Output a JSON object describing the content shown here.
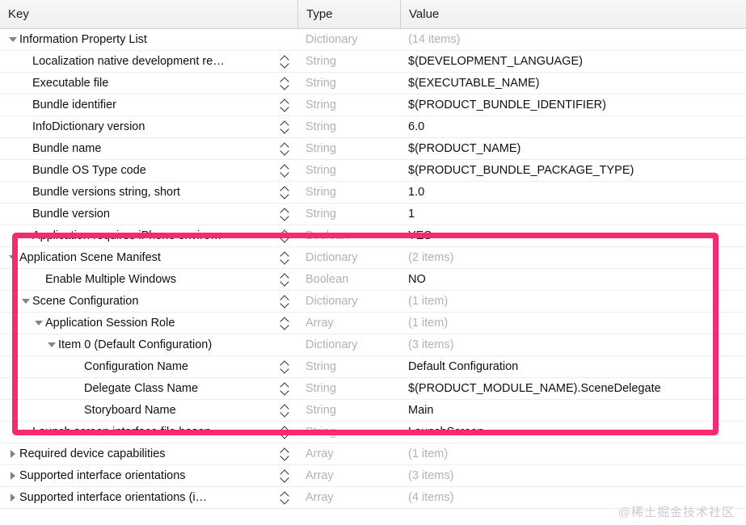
{
  "header": {
    "key_label": "Key",
    "type_label": "Type",
    "value_label": "Value"
  },
  "colors": {
    "highlight": "#f72a6d",
    "type_text": "#b2b2b2",
    "value_text": "#101010",
    "watermark": "#c9cbd0"
  },
  "watermark": "@稀土掘金技术社区",
  "rows": [
    {
      "key": "Information Property List",
      "type": "Dictionary",
      "value": "(14 items)",
      "value_muted": true,
      "indent": 0,
      "disclosure": "open",
      "stepper": false
    },
    {
      "key": "Localization native development re…",
      "type": "String",
      "value": "$(DEVELOPMENT_LANGUAGE)",
      "value_muted": false,
      "indent": 1,
      "disclosure": "none",
      "stepper": true
    },
    {
      "key": "Executable file",
      "type": "String",
      "value": "$(EXECUTABLE_NAME)",
      "value_muted": false,
      "indent": 1,
      "disclosure": "none",
      "stepper": true
    },
    {
      "key": "Bundle identifier",
      "type": "String",
      "value": "$(PRODUCT_BUNDLE_IDENTIFIER)",
      "value_muted": false,
      "indent": 1,
      "disclosure": "none",
      "stepper": true
    },
    {
      "key": "InfoDictionary version",
      "type": "String",
      "value": "6.0",
      "value_muted": false,
      "indent": 1,
      "disclosure": "none",
      "stepper": true
    },
    {
      "key": "Bundle name",
      "type": "String",
      "value": "$(PRODUCT_NAME)",
      "value_muted": false,
      "indent": 1,
      "disclosure": "none",
      "stepper": true
    },
    {
      "key": "Bundle OS Type code",
      "type": "String",
      "value": "$(PRODUCT_BUNDLE_PACKAGE_TYPE)",
      "value_muted": false,
      "indent": 1,
      "disclosure": "none",
      "stepper": true
    },
    {
      "key": "Bundle versions string, short",
      "type": "String",
      "value": "1.0",
      "value_muted": false,
      "indent": 1,
      "disclosure": "none",
      "stepper": true
    },
    {
      "key": "Bundle version",
      "type": "String",
      "value": "1",
      "value_muted": false,
      "indent": 1,
      "disclosure": "none",
      "stepper": true
    },
    {
      "key": "Application requires iPhone enviro…",
      "type": "Boolean",
      "value": "YES",
      "value_muted": false,
      "indent": 1,
      "disclosure": "none",
      "stepper": true
    },
    {
      "key": "Application Scene Manifest",
      "type": "Dictionary",
      "value": "(2 items)",
      "value_muted": true,
      "indent": 0,
      "disclosure": "open",
      "stepper": true
    },
    {
      "key": "Enable Multiple Windows",
      "type": "Boolean",
      "value": "NO",
      "value_muted": false,
      "indent": 2,
      "disclosure": "none",
      "stepper": true
    },
    {
      "key": "Scene Configuration",
      "type": "Dictionary",
      "value": "(1 item)",
      "value_muted": true,
      "indent": 1,
      "disclosure": "open",
      "stepper": true
    },
    {
      "key": "Application Session Role",
      "type": "Array",
      "value": "(1 item)",
      "value_muted": true,
      "indent": 2,
      "disclosure": "open",
      "stepper": true
    },
    {
      "key": "Item 0 (Default Configuration)",
      "type": "Dictionary",
      "value": "(3 items)",
      "value_muted": true,
      "indent": 3,
      "disclosure": "open",
      "stepper": false
    },
    {
      "key": "Configuration Name",
      "type": "String",
      "value": "Default Configuration",
      "value_muted": false,
      "indent": 5,
      "disclosure": "none",
      "stepper": true
    },
    {
      "key": "Delegate Class Name",
      "type": "String",
      "value": "$(PRODUCT_MODULE_NAME).SceneDelegate",
      "value_muted": false,
      "indent": 5,
      "disclosure": "none",
      "stepper": true
    },
    {
      "key": "Storyboard Name",
      "type": "String",
      "value": "Main",
      "value_muted": false,
      "indent": 5,
      "disclosure": "none",
      "stepper": true
    },
    {
      "key": "Launch screen interface file basen…",
      "type": "String",
      "value": "LaunchScreen",
      "value_muted": false,
      "indent": 1,
      "disclosure": "none",
      "stepper": true
    },
    {
      "key": "Required device capabilities",
      "type": "Array",
      "value": "(1 item)",
      "value_muted": true,
      "indent": 0,
      "disclosure": "closed",
      "stepper": true
    },
    {
      "key": "Supported interface orientations",
      "type": "Array",
      "value": "(3 items)",
      "value_muted": true,
      "indent": 0,
      "disclosure": "closed",
      "stepper": true
    },
    {
      "key": "Supported interface orientations (i…",
      "type": "Array",
      "value": "(4 items)",
      "value_muted": true,
      "indent": 0,
      "disclosure": "closed",
      "stepper": true
    }
  ]
}
